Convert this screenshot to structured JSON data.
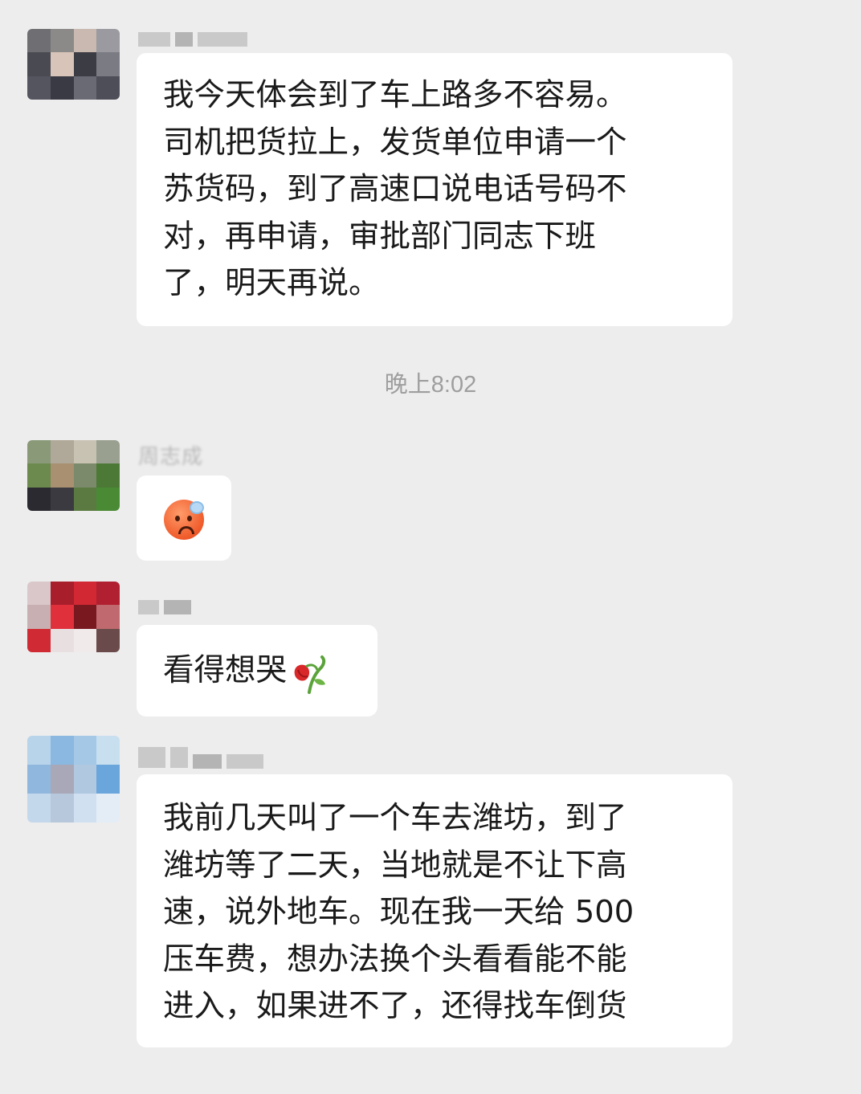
{
  "messages": [
    {
      "id": "m1",
      "lines": [
        "我今天体会到了车上路多不容易。",
        "司机把货拉上，发货单位申请一个",
        "苏货码，到了高速口说电话号码不",
        "对，再申请，审批部门同志下班",
        "了，明天再说。"
      ]
    },
    {
      "id": "m2",
      "sender": "周志成",
      "emoji": "cold-sweat-face-icon"
    },
    {
      "id": "m3",
      "text": "看得想哭",
      "emoji": "wilted-flower-icon"
    },
    {
      "id": "m4",
      "lines": [
        "我前几天叫了一个车去潍坊，到了",
        "潍坊等了二天，当地就是不让下高",
        "速，说外地车。现在我一天给 500",
        "压车费，想办法换个头看看能不能",
        "进入，如果进不了，还得找车倒货"
      ]
    }
  ],
  "timestamp": "晚上8:02"
}
